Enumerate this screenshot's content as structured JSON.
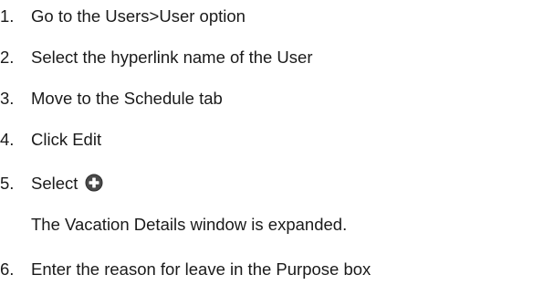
{
  "steps": [
    {
      "num": "1.",
      "text": "Go to the Users>User option"
    },
    {
      "num": "2.",
      "text": "Select the hyperlink name of the User"
    },
    {
      "num": "3.",
      "text": "Move to the Schedule tab"
    },
    {
      "num": "4.",
      "text": "Click Edit"
    },
    {
      "num": "5.",
      "text": "Select",
      "icon": "plus-circle-icon",
      "note": "The Vacation Details window is expanded."
    },
    {
      "num": "6.",
      "text": "Enter the reason for leave in the Purpose box"
    }
  ],
  "colors": {
    "text": "#1a1a1a",
    "icon_fill": "#4a4a4a"
  }
}
